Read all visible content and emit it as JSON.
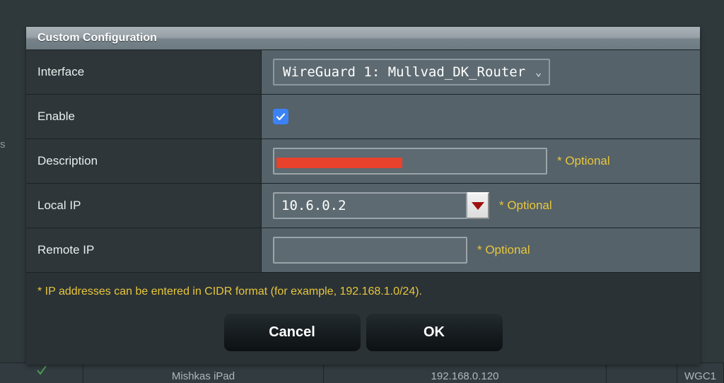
{
  "background": {
    "left_edge_text": "s",
    "table_row": {
      "checkbox_icon": "check-icon",
      "name": "Mishkas iPad",
      "ip": "192.168.0.120",
      "blank": "",
      "interface": "WGC1"
    }
  },
  "dialog": {
    "title": "Custom Configuration",
    "rows": [
      {
        "label": "Interface"
      },
      {
        "label": "Enable"
      },
      {
        "label": "Description"
      },
      {
        "label": "Local IP"
      },
      {
        "label": "Remote IP"
      }
    ],
    "interface": {
      "selected": "WireGuard 1: Mullvad_DK_Router",
      "chevron": "ˇ",
      "chevron_icon": "chevron-down-icon"
    },
    "enable": {
      "checked": true,
      "icon": "checkmark-icon"
    },
    "description": {
      "value": "",
      "redacted": true,
      "optional_note": "* Optional"
    },
    "local_ip": {
      "value": "10.6.0.2",
      "dropdown_icon": "triangle-down-icon",
      "optional_note": "* Optional"
    },
    "remote_ip": {
      "value": "",
      "optional_note": "* Optional"
    },
    "cidr_note": "* IP addresses can be entered in CIDR format (for example, 192.168.1.0/24).",
    "buttons": {
      "cancel": "Cancel",
      "ok": "OK"
    },
    "colors": {
      "accent_yellow": "#e8c63b",
      "checkbox_blue": "#3b82f6",
      "redaction_red": "#e8412c",
      "arrow_red": "#9e1010",
      "panel_bg": "#2a3236",
      "value_cell_bg": "#556269",
      "label_cell_bg": "#2e3639"
    }
  }
}
